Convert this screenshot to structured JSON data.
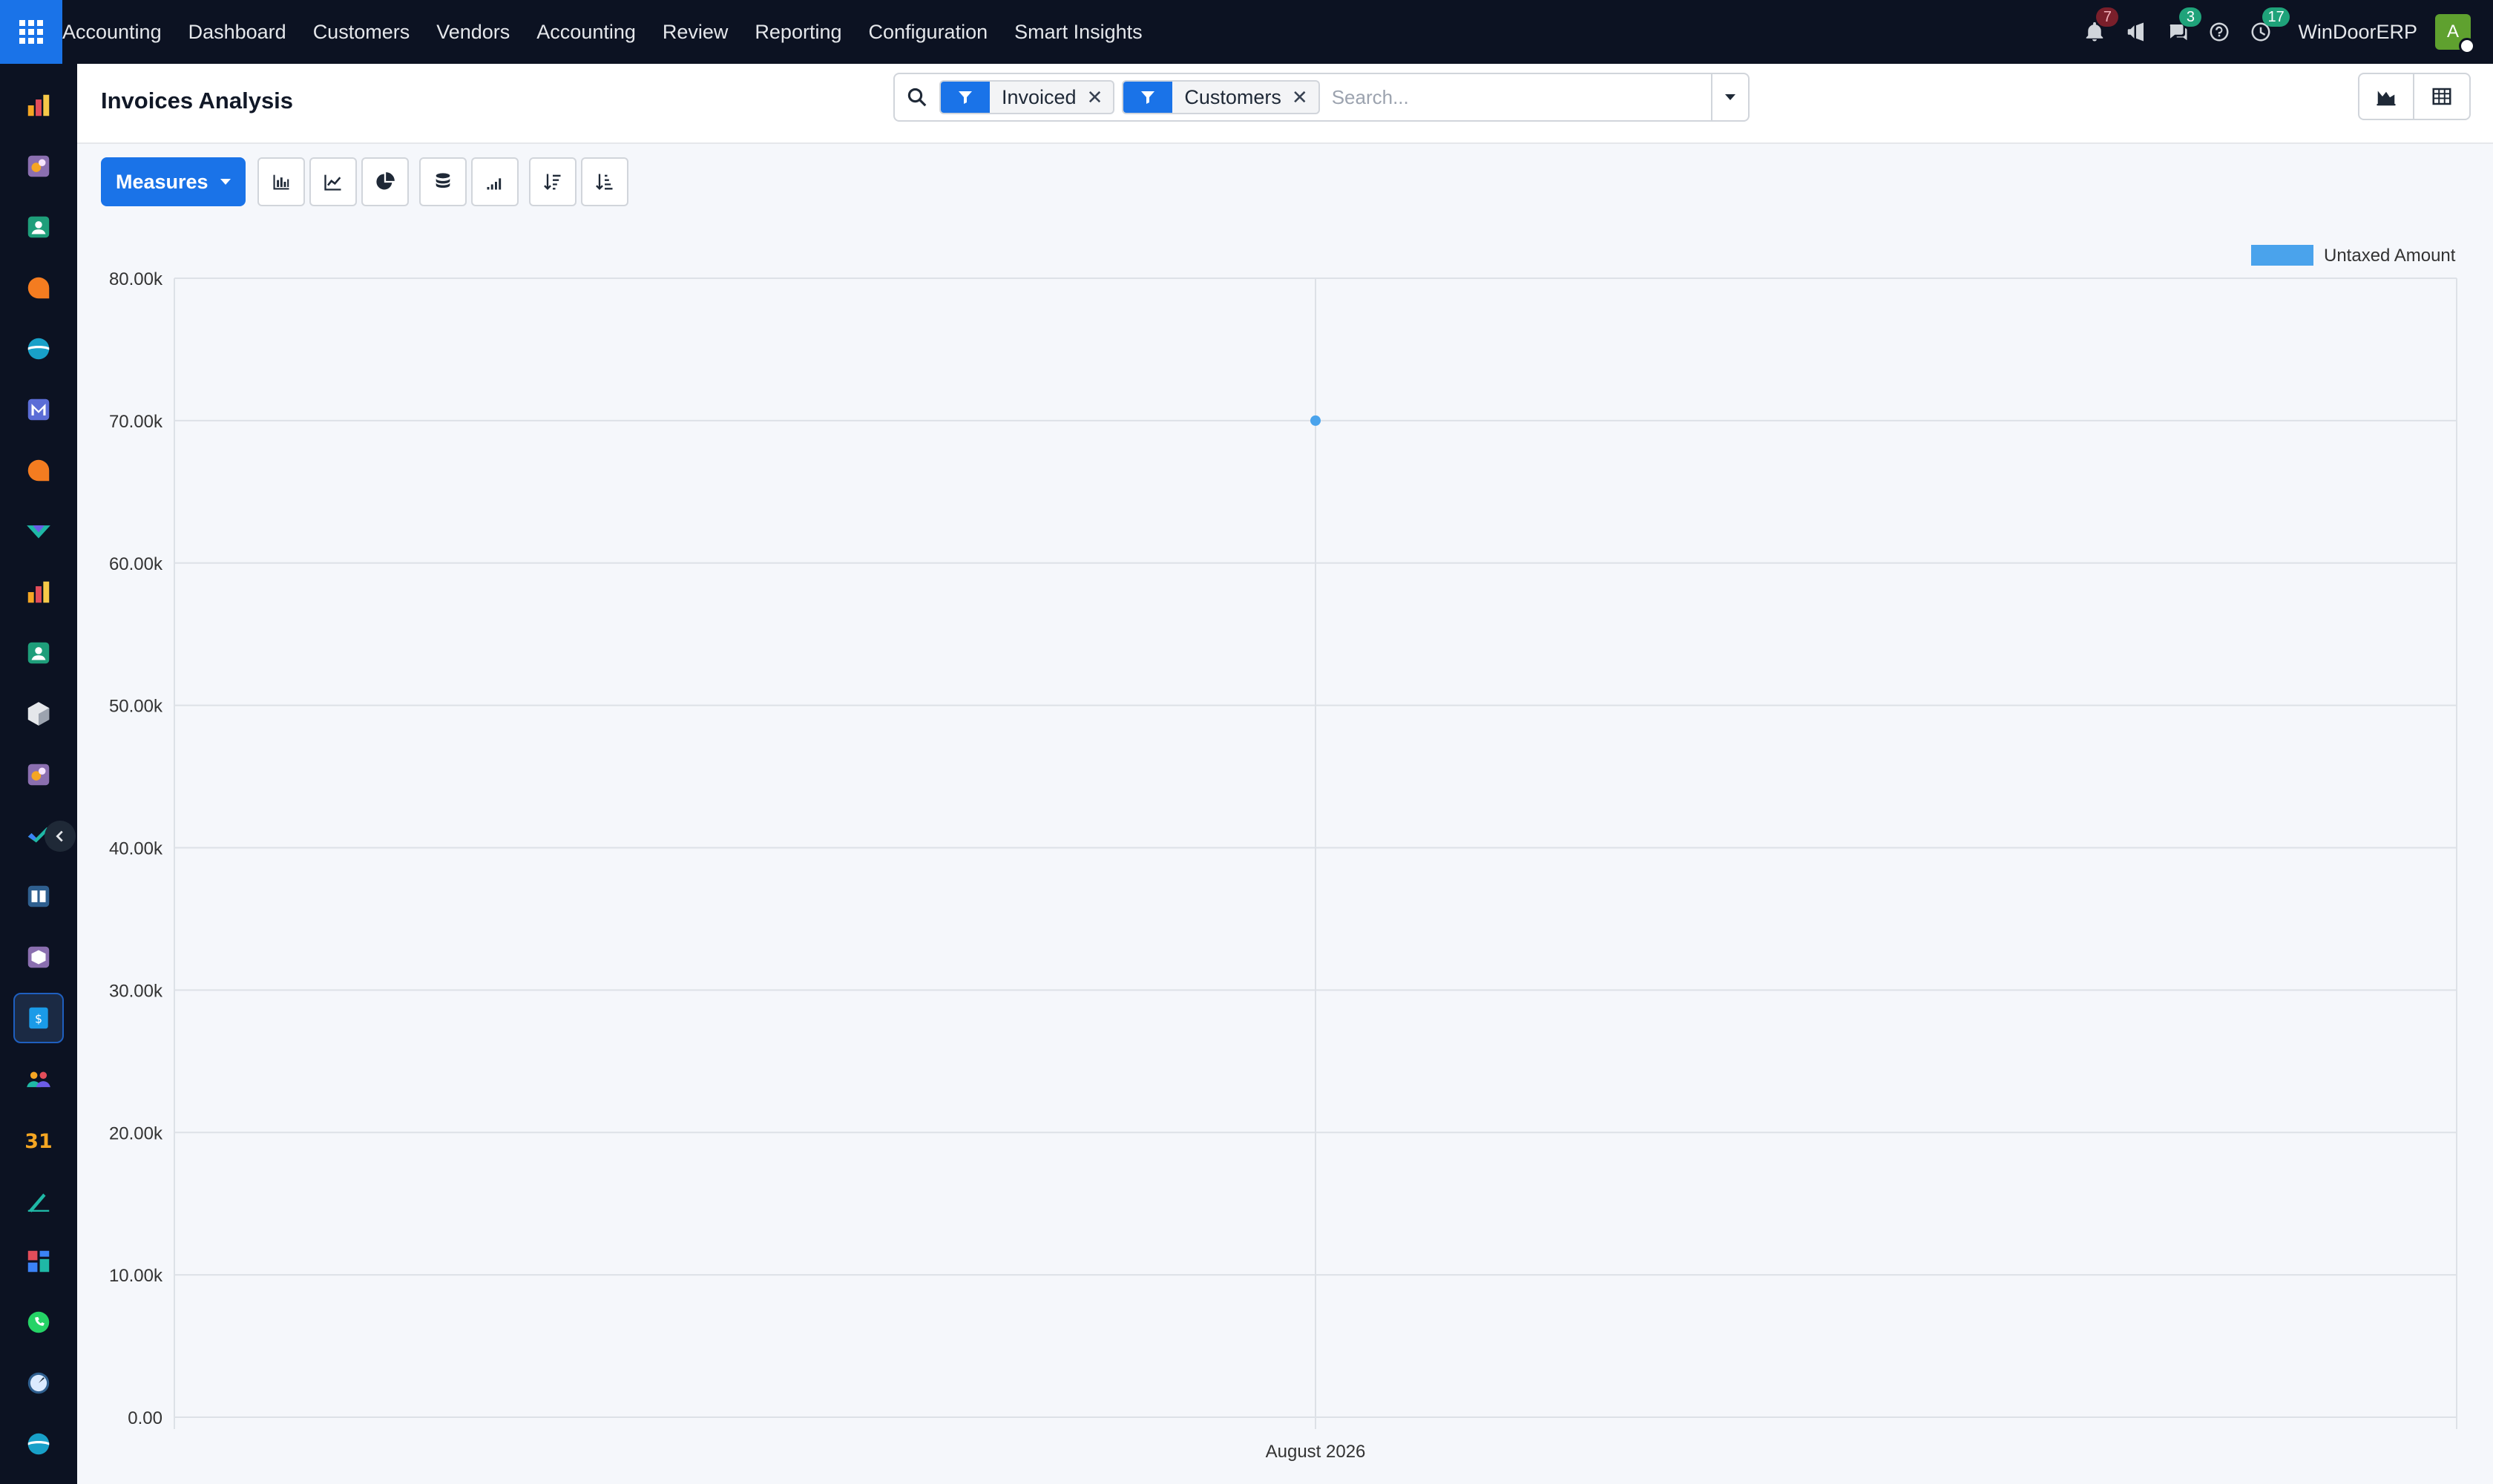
{
  "topbar": {
    "brand": "Accounting",
    "menu": [
      "Dashboard",
      "Customers",
      "Vendors",
      "Accounting",
      "Review",
      "Reporting",
      "Configuration",
      "Smart Insights"
    ],
    "notifications_count": "7",
    "messages_count": "3",
    "activities_count": "17",
    "company": "WinDoorERP",
    "avatar_initial": "A"
  },
  "sidebar": {
    "icons": [
      "invoicing-app-icon",
      "sales-app-icon",
      "contacts-app-icon",
      "discuss-app-icon",
      "website-app-icon",
      "email-marketing-app-icon",
      "livechat-app-icon",
      "project-app-icon",
      "crm-app-icon",
      "employees-app-icon",
      "inventory-app-icon",
      "expenses-app-icon",
      "approvals-app-icon",
      "knowledge-app-icon",
      "purchase-app-icon",
      "accounting-app-icon",
      "recruitment-app-icon",
      "calendar-app-icon",
      "sign-app-icon",
      "dashboards-app-icon",
      "whatsapp-app-icon",
      "timesheets-app-icon",
      "website-builder-app-icon"
    ],
    "calendar_day": "31"
  },
  "control": {
    "title": "Invoices Analysis",
    "facets": [
      {
        "label": "Invoiced"
      },
      {
        "label": "Customers"
      }
    ],
    "search_placeholder": "Search..."
  },
  "toolbar": {
    "measures_label": "Measures"
  },
  "colors": {
    "accent": "#1a73e8",
    "series": "#4aa3ec",
    "navbar": "#0c1222"
  },
  "chart_data": {
    "type": "line",
    "categories": [
      "August 2026"
    ],
    "series": [
      {
        "name": "Untaxed Amount",
        "values": [
          70000
        ]
      }
    ],
    "ylim": [
      0,
      80000
    ],
    "y_ticks": [
      "0.00",
      "10.00k",
      "20.00k",
      "30.00k",
      "40.00k",
      "50.00k",
      "60.00k",
      "70.00k",
      "80.00k"
    ],
    "grid": true,
    "legend": "top-right"
  }
}
